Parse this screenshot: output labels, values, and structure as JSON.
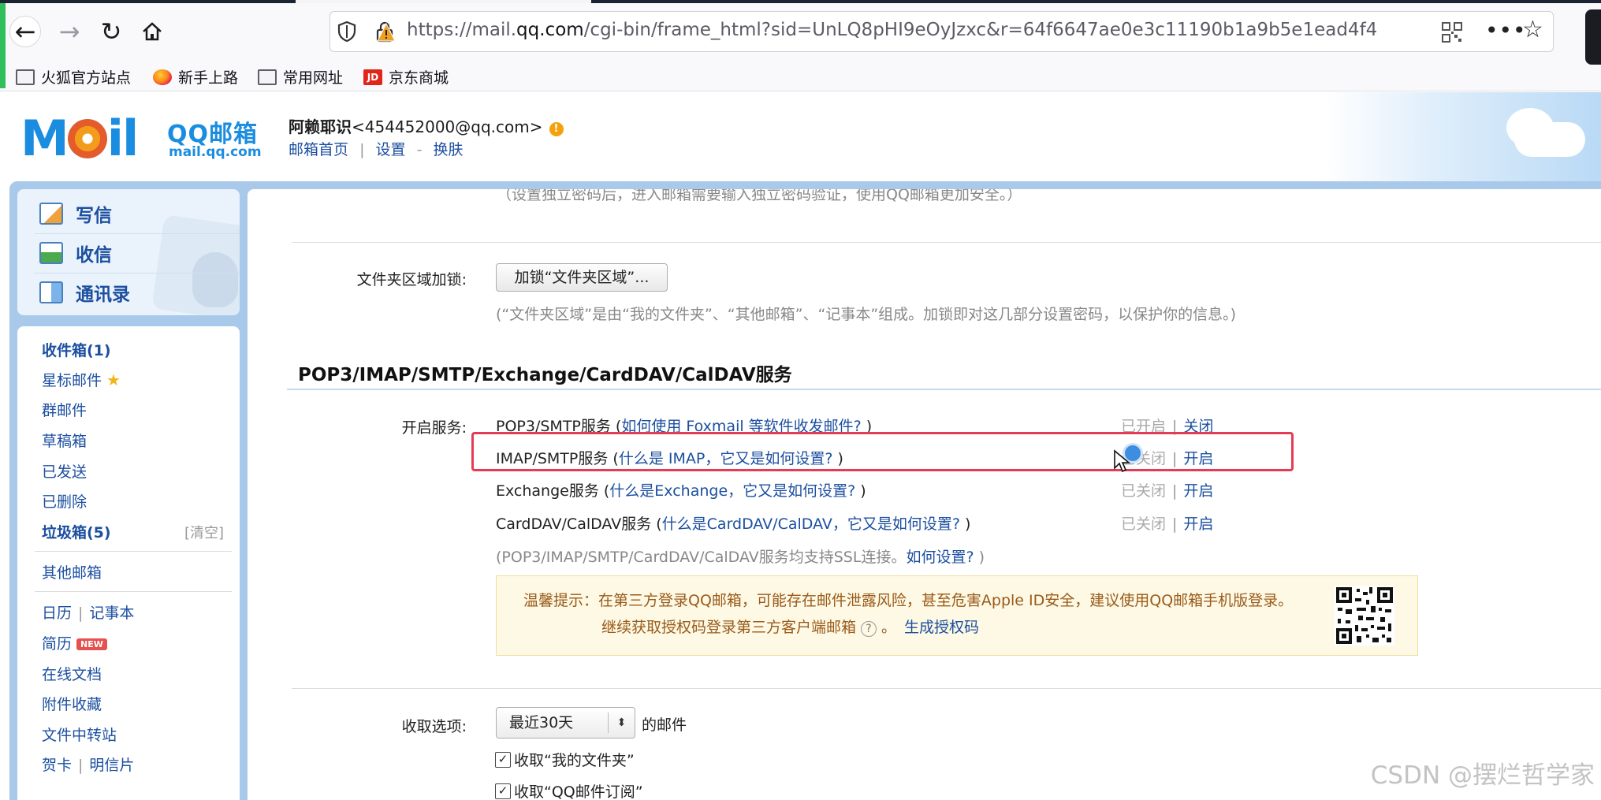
{
  "browser": {
    "url_prefix": "https://mail.",
    "url_domain": "qq.com",
    "url_rest": "/cgi-bin/frame_html?sid=UnLQ8pHI9eOyJzxc&r=64f6647ae0e3c11190b1a9b5e1ead4f4",
    "bookmarks": [
      {
        "label": "火狐官方站点",
        "icon": "folder-icon"
      },
      {
        "label": "新手上路",
        "icon": "firefox-icon"
      },
      {
        "label": "常用网址",
        "icon": "folder-icon"
      },
      {
        "label": "京东商城",
        "icon": "jd-icon"
      }
    ],
    "jd_letter": "JD"
  },
  "header": {
    "logo_word_left": "M",
    "logo_word_right": "il",
    "logo_cn": "QQ邮箱",
    "logo_sub": "mail.qq.com",
    "user_name": "阿赖耶识",
    "user_email": "<454452000@qq.com>",
    "warn_mark": "!",
    "links": {
      "home": "邮箱首页",
      "settings": "设置",
      "skin": "换肤",
      "sep1": "|",
      "sep2": "-"
    }
  },
  "quick_actions": {
    "write": "写信",
    "inbox": "收信",
    "contacts": "通讯录"
  },
  "folders": {
    "inbox": "收件箱(1)",
    "starred": "星标邮件",
    "star_mark": "★",
    "group": "群邮件",
    "drafts": "草稿箱",
    "sent": "已发送",
    "deleted": "已删除",
    "spam": "垃圾箱(5)",
    "clear": "[清空]",
    "other_mail": "其他邮箱",
    "calendar": "日历",
    "notes": "记事本",
    "resume": "简历",
    "new_badge": "NEW",
    "docs": "在线文档",
    "attachments": "附件收藏",
    "transfer": "文件中转站",
    "cards": "贺卡",
    "postcards": "明信片",
    "pipe": "|"
  },
  "content": {
    "top_note": "（设置独立密码后，进入邮箱需要输入独立密码验证，使用QQ邮箱更加安全。）",
    "folder_lock_label": "文件夹区域加锁:",
    "folder_lock_button": "加锁“文件夹区域”...",
    "folder_lock_note": "(“文件夹区域”是由“我的文件夹”、“其他邮箱”、“记事本”组成。加锁即对这几部分设置密码，以保护你的信息。)",
    "section_title": "POP3/IMAP/SMTP/Exchange/CardDAV/CalDAV服务",
    "enable_label": "开启服务:",
    "services": [
      {
        "name": "POP3/SMTP服务",
        "open": " (",
        "help": "如何使用 Foxmail 等软件收发邮件?",
        "close": " )",
        "state": "已开启",
        "sep": "|",
        "action": "关闭"
      },
      {
        "name": "IMAP/SMTP服务",
        "open": " (",
        "help": "什么是 IMAP，它又是如何设置?",
        "close": " )",
        "state": "已关闭",
        "sep": "|",
        "action": "开启"
      },
      {
        "name": "Exchange服务",
        "open": " (",
        "help": "什么是Exchange，它又是如何设置?",
        "close": " )",
        "state": "已关闭",
        "sep": "|",
        "action": "开启"
      },
      {
        "name": "CardDAV/CalDAV服务",
        "open": " (",
        "help": "什么是CardDAV/CalDAV，它又是如何设置?",
        "close": " )",
        "state": "已关闭",
        "sep": "|",
        "action": "开启"
      }
    ],
    "ssl_note": "(POP3/IMAP/SMTP/CardDAV/CalDAV服务均支持SSL连接。",
    "ssl_link": "如何设置?",
    "ssl_close": " )",
    "tip_line1": "温馨提示：在第三方登录QQ邮箱，可能存在邮件泄露风险，甚至危害Apple ID安全，建议使用QQ邮箱手机版登录。",
    "tip_line2": "继续获取授权码登录第三方客户端邮箱",
    "tip_help": "?",
    "tip_period": "。",
    "tip_link": "生成授权码",
    "receive_label": "收取选项:",
    "receive_period": "最近30天",
    "receive_suffix": "的邮件",
    "check_mark": "✓",
    "check1": "收取“我的文件夹”",
    "check2": "收取“QQ邮件订阅”"
  },
  "watermark": "CSDN @摆烂哲学家"
}
